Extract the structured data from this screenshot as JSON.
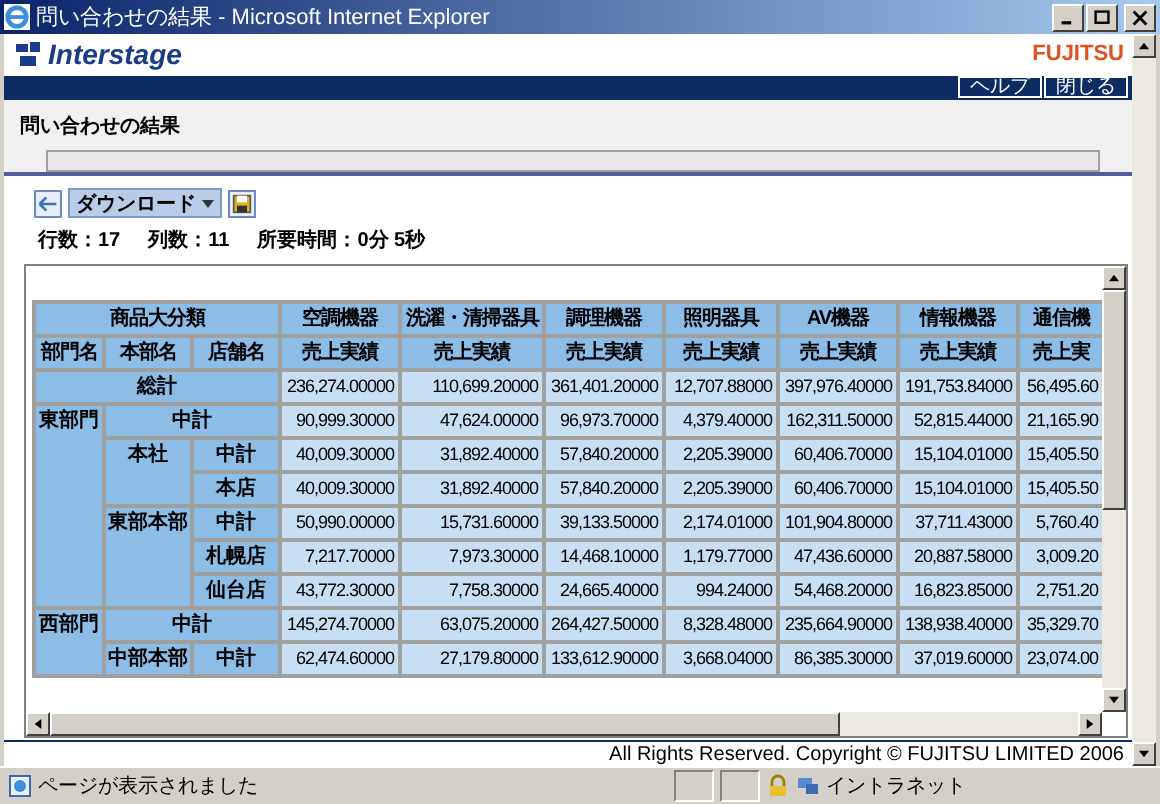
{
  "window": {
    "title": "問い合わせの結果 - Microsoft Internet Explorer"
  },
  "header": {
    "logo": "Interstage",
    "brand": "FUJITSU",
    "buttons": [
      "ヘルプ",
      "閉じる"
    ]
  },
  "page": {
    "title": "問い合わせの結果"
  },
  "toolbar": {
    "download": "ダウンロード"
  },
  "info": [
    "行数：17",
    "列数：11",
    "所要時間：0分 5秒"
  ],
  "table": {
    "corner": "商品大分類",
    "row_headers": [
      "部門名",
      "本部名",
      "店舗名"
    ],
    "columns": [
      {
        "name": "空調機器",
        "measure": "売上実績"
      },
      {
        "name": "洗濯・清掃器具",
        "measure": "売上実績"
      },
      {
        "name": "調理機器",
        "measure": "売上実績"
      },
      {
        "name": "照明器具",
        "measure": "売上実績"
      },
      {
        "name": "AV機器",
        "measure": "売上実績"
      },
      {
        "name": "情報機器",
        "measure": "売上実績"
      },
      {
        "name": "通信機",
        "measure": "売上実"
      }
    ],
    "total": {
      "label": "総計",
      "values": [
        "236,274.00000",
        "110,699.20000",
        "361,401.20000",
        "12,707.88000",
        "397,976.40000",
        "191,753.84000",
        "56,495.60"
      ]
    },
    "departments": [
      {
        "name": "東部門",
        "subtotal": {
          "label": "中計",
          "values": [
            "90,999.30000",
            "47,624.00000",
            "96,973.70000",
            "4,379.40000",
            "162,311.50000",
            "52,815.44000",
            "21,165.90"
          ]
        },
        "children": [
          {
            "name": "本社",
            "rows": [
              {
                "label": "中計",
                "values": [
                  "40,009.30000",
                  "31,892.40000",
                  "57,840.20000",
                  "2,205.39000",
                  "60,406.70000",
                  "15,104.01000",
                  "15,405.50"
                ]
              },
              {
                "label": "本店",
                "values": [
                  "40,009.30000",
                  "31,892.40000",
                  "57,840.20000",
                  "2,205.39000",
                  "60,406.70000",
                  "15,104.01000",
                  "15,405.50"
                ]
              }
            ]
          },
          {
            "name": "東部本部",
            "rows": [
              {
                "label": "中計",
                "values": [
                  "50,990.00000",
                  "15,731.60000",
                  "39,133.50000",
                  "2,174.01000",
                  "101,904.80000",
                  "37,711.43000",
                  "5,760.40"
                ]
              },
              {
                "label": "札幌店",
                "values": [
                  "7,217.70000",
                  "7,973.30000",
                  "14,468.10000",
                  "1,179.77000",
                  "47,436.60000",
                  "20,887.58000",
                  "3,009.20"
                ]
              },
              {
                "label": "仙台店",
                "values": [
                  "43,772.30000",
                  "7,758.30000",
                  "24,665.40000",
                  "994.24000",
                  "54,468.20000",
                  "16,823.85000",
                  "2,751.20"
                ]
              }
            ]
          }
        ]
      },
      {
        "name": "西部門",
        "subtotal": {
          "label": "中計",
          "values": [
            "145,274.70000",
            "63,075.20000",
            "264,427.50000",
            "8,328.48000",
            "235,664.90000",
            "138,938.40000",
            "35,329.70"
          ]
        },
        "children": [
          {
            "name": "中部本部",
            "rows": [
              {
                "label": "中計",
                "values": [
                  "62,474.60000",
                  "27,179.80000",
                  "133,612.90000",
                  "3,668.04000",
                  "86,385.30000",
                  "37,019.60000",
                  "23,074.00"
                ]
              }
            ]
          }
        ]
      }
    ]
  },
  "footer": {
    "copyright": "All Rights Reserved. Copyright © FUJITSU LIMITED 2006"
  },
  "status_bar": {
    "text": "ページが表示されました",
    "zone": "イントラネット"
  }
}
